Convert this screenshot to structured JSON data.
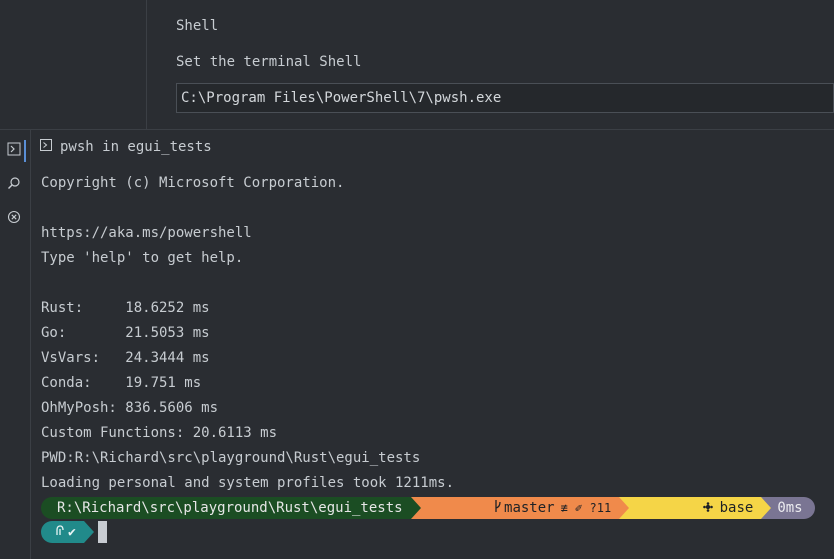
{
  "settings": {
    "title": "Shell",
    "description": "Set the terminal Shell",
    "shell_path": "C:\\Program Files\\PowerShell\\7\\pwsh.exe"
  },
  "activity_bar": {
    "items": [
      {
        "icon": "terminal-icon",
        "active": true
      },
      {
        "icon": "search-icon",
        "active": false
      },
      {
        "icon": "close-circle-icon",
        "active": false
      }
    ]
  },
  "terminal": {
    "header": "pwsh in egui_tests",
    "lines": [
      "Copyright (c) Microsoft Corporation.",
      "",
      "https://aka.ms/powershell",
      "Type 'help' to get help.",
      "",
      "Rust:     18.6252 ms",
      "Go:       21.5053 ms",
      "VsVars:   24.3444 ms",
      "Conda:    19.751 ms",
      "OhMyPosh: 836.5606 ms",
      "Custom Functions: 20.6113 ms",
      "PWD:R:\\Richard\\src\\playground\\Rust\\egui_tests",
      "Loading personal and system profiles took 1211ms."
    ],
    "prompt": {
      "path": "R:\\Richard\\src\\playground\\Rust\\egui_tests",
      "git_branch": "master",
      "git_status": "≢ ✐ ?11",
      "env": "base",
      "time": "0ms"
    },
    "status_glyph": "✔"
  },
  "colors": {
    "accent": "#5a8fd6",
    "path_segment": "#1b4d23",
    "git_segment": "#f08a4b",
    "env_segment": "#f5d547",
    "time_segment": "#7a7593",
    "status_segment": "#218a8a"
  }
}
